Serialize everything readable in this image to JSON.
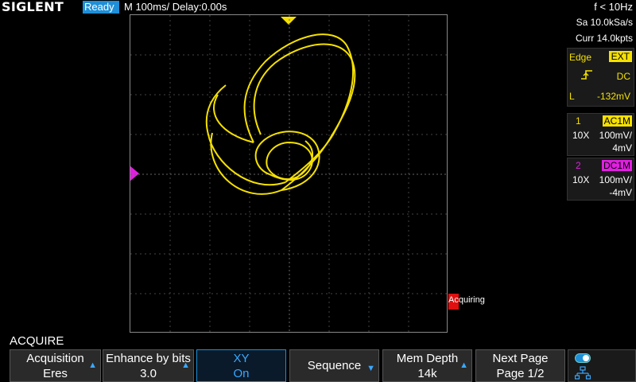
{
  "brand": "SIGLENT",
  "status": "Ready",
  "timebase": "M 100ms/",
  "delay": "Delay:0.00s",
  "frequency": "f < 10Hz",
  "sample_rate": "Sa 10.0kSa/s",
  "curr_depth": "Curr 14.0kpts",
  "trigger": {
    "type": "Edge",
    "source": "EXT",
    "slope_icon": "rising-edge-icon",
    "coupling": "DC",
    "level_label": "L",
    "level": "-132mV"
  },
  "channels": [
    {
      "num": "1",
      "badge": "AC1M",
      "probe": "10X",
      "scale": "100mV/",
      "offset": "4mV",
      "color": "#f5e000"
    },
    {
      "num": "2",
      "badge": "DC1M",
      "probe": "10X",
      "scale": "100mV/",
      "offset": "-4mV",
      "color": "#e020e0"
    }
  ],
  "acquiring": "Acquiring",
  "menu": {
    "title": "ACQUIRE",
    "keys": [
      {
        "line1": "Acquisition",
        "line2": "Eres"
      },
      {
        "line1": "Enhance by bits",
        "line2": "3.0"
      },
      {
        "line1": "XY",
        "line2": "On"
      },
      {
        "line1": "Sequence",
        "line2": ""
      },
      {
        "line1": "Mem Depth",
        "line2": "14k"
      },
      {
        "line1": "Next Page",
        "line2": "Page 1/2"
      }
    ]
  },
  "colors": {
    "accent": "#1e8fd8",
    "trace": "#f5e000",
    "ch2": "#e020e0",
    "flag": "#e01010"
  }
}
